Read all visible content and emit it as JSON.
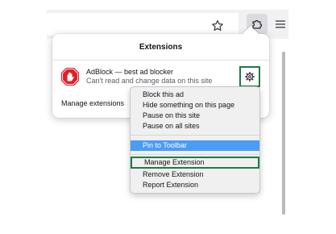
{
  "panel": {
    "title": "Extensions",
    "extension": {
      "name": "AdBlock — best ad blocker",
      "permission": "Can't read and change data on this site",
      "icon": "adblock-hand-icon"
    },
    "manage_link": "Manage extensions"
  },
  "toolbar": {
    "icons": [
      "star-icon",
      "puzzle-icon",
      "hamburger-menu-icon"
    ]
  },
  "context_menu": {
    "items": [
      {
        "label": "Block this ad"
      },
      {
        "label": "Hide something on this page"
      },
      {
        "label": "Pause on this site"
      },
      {
        "label": "Pause on all sites"
      },
      {
        "label": "Pin to Toolbar",
        "state": "highlighted"
      },
      {
        "label": "Manage Extension",
        "state": "outlined"
      },
      {
        "label": "Remove Extension"
      },
      {
        "label": "Report Extension"
      }
    ]
  },
  "colors": {
    "highlight": "#4b9cf5",
    "outline": "#1f7a45",
    "adblock_red": "#e21e26"
  }
}
